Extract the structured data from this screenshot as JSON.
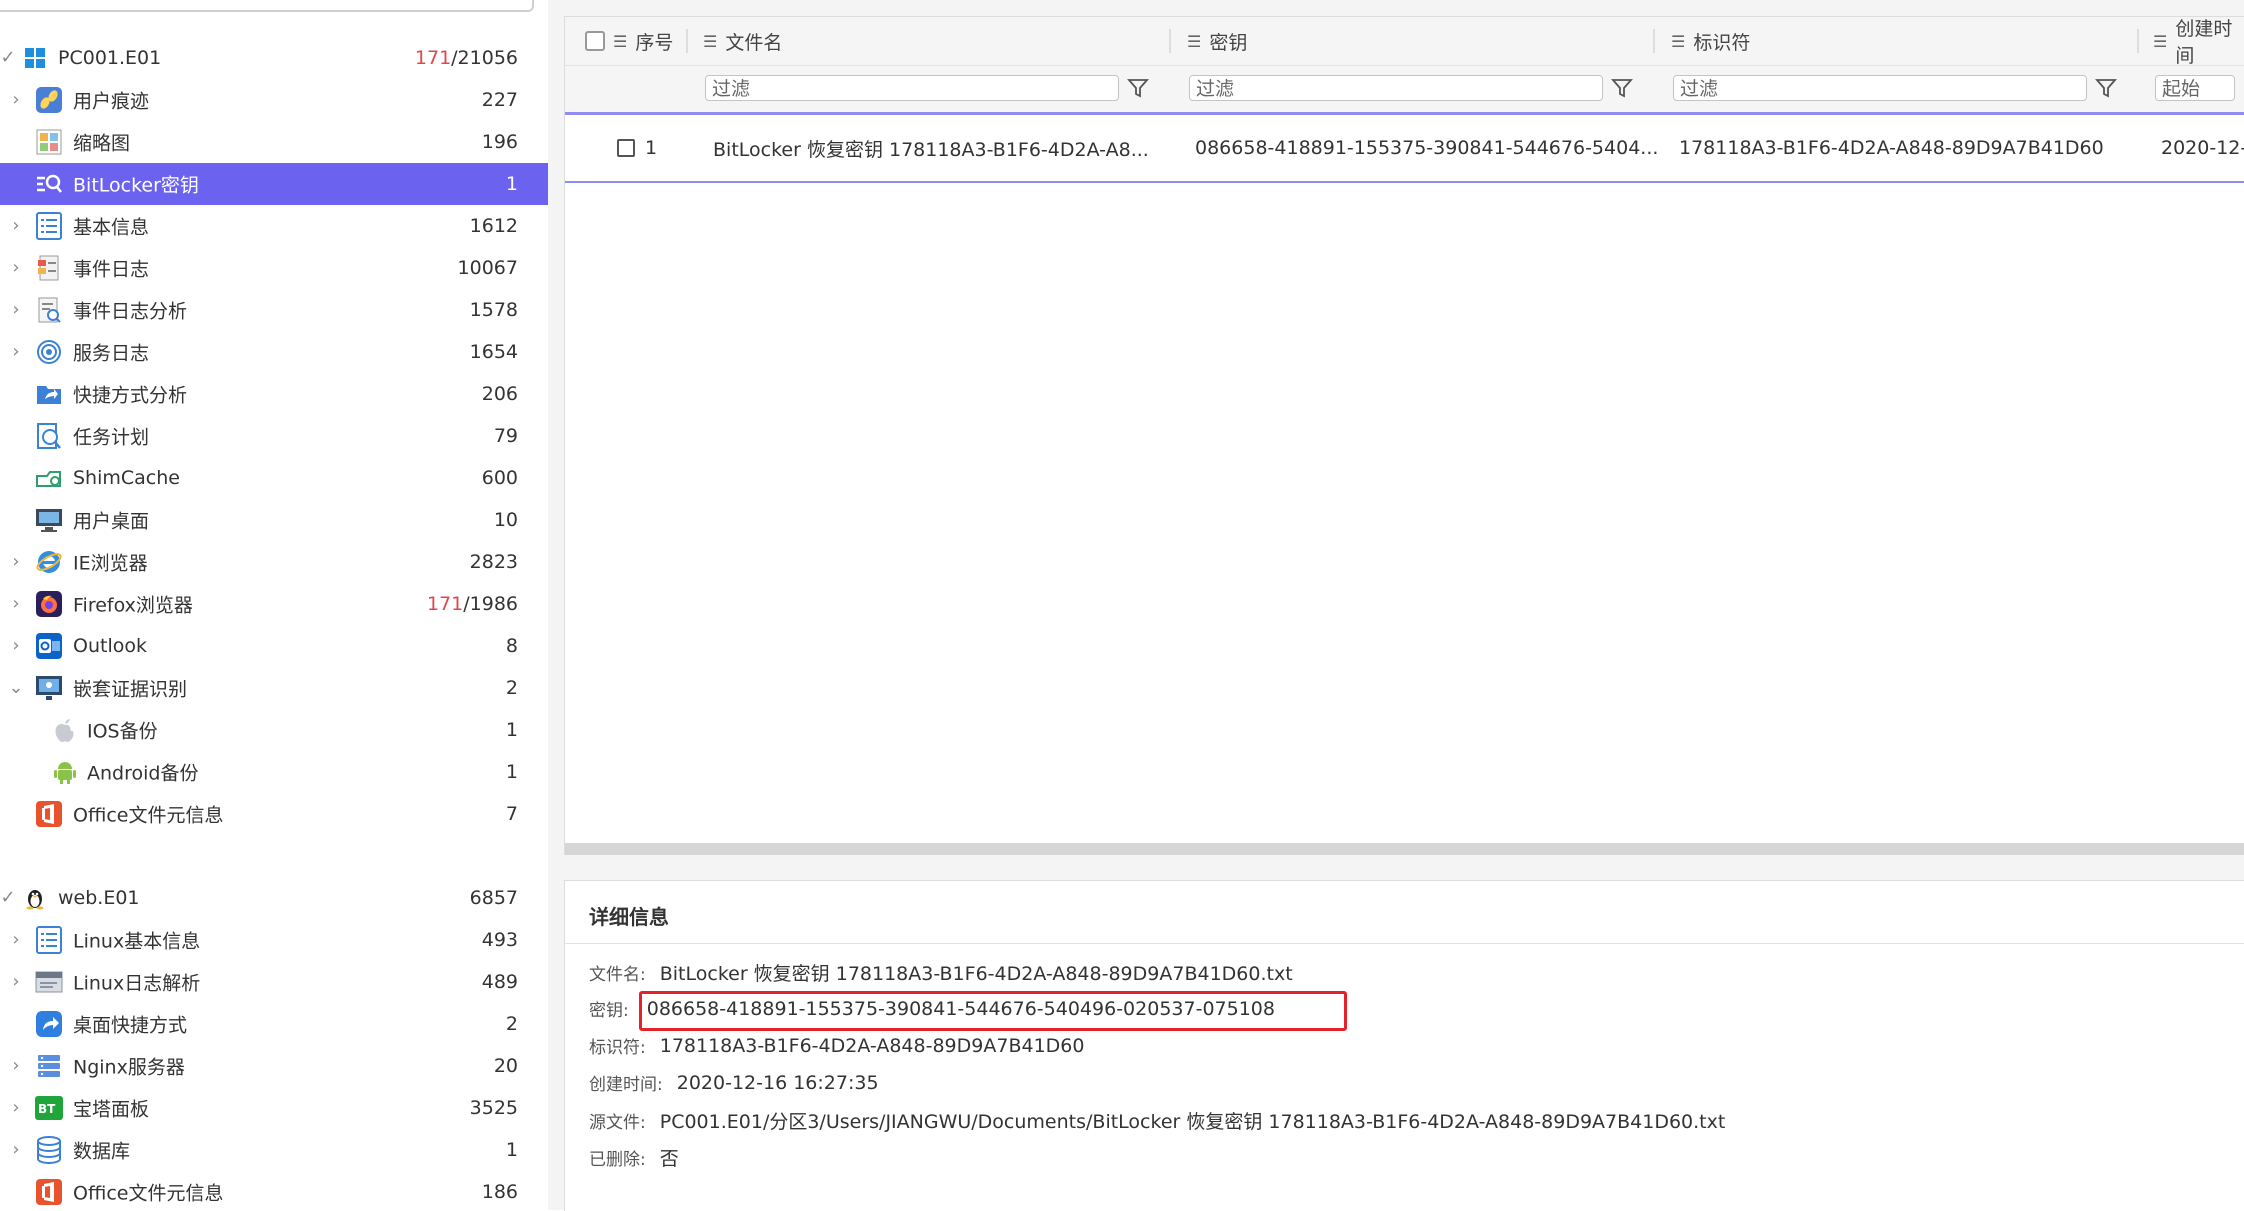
{
  "tree": {
    "groups": [
      {
        "label": "PC001.E01",
        "count_red": "171",
        "count_rest": "/21056"
      },
      {
        "label": "web.E01",
        "count": "6857"
      }
    ],
    "pc_items": [
      {
        "label": "用户痕迹",
        "count": "227",
        "icon": "footprint-icon"
      },
      {
        "label": "缩略图",
        "count": "196",
        "icon": "thumbnail-icon"
      },
      {
        "label": "BitLocker密钥",
        "count": "1",
        "icon": "key-search-icon"
      },
      {
        "label": "基本信息",
        "count": "1612",
        "icon": "info-list-icon"
      },
      {
        "label": "事件日志",
        "count": "10067",
        "icon": "event-log-icon"
      },
      {
        "label": "事件日志分析",
        "count": "1578",
        "icon": "log-analysis-icon"
      },
      {
        "label": "服务日志",
        "count": "1654",
        "icon": "service-log-icon"
      },
      {
        "label": "快捷方式分析",
        "count": "206",
        "icon": "shortcut-folder-icon"
      },
      {
        "label": "任务计划",
        "count": "79",
        "icon": "task-schedule-icon"
      },
      {
        "label": "ShimCache",
        "count": "600",
        "icon": "shimcache-icon"
      },
      {
        "label": "用户桌面",
        "count": "10",
        "icon": "desktop-icon"
      },
      {
        "label": "IE浏览器",
        "count": "2823",
        "icon": "ie-browser-icon"
      },
      {
        "label": "Firefox浏览器",
        "count_red": "171",
        "count_rest": "/1986",
        "icon": "firefox-icon"
      },
      {
        "label": "Outlook",
        "count": "8",
        "icon": "outlook-icon"
      },
      {
        "label": "嵌套证据识别",
        "count": "2",
        "icon": "nested-evidence-icon"
      },
      {
        "label": "IOS备份",
        "count": "1",
        "icon": "apple-icon"
      },
      {
        "label": "Android备份",
        "count": "1",
        "icon": "android-icon"
      },
      {
        "label": "Office文件元信息",
        "count": "7",
        "icon": "office-icon"
      }
    ],
    "web_items": [
      {
        "label": "Linux基本信息",
        "count": "493",
        "icon": "info-list-icon"
      },
      {
        "label": "Linux日志解析",
        "count": "489",
        "icon": "log-file-icon"
      },
      {
        "label": "桌面快捷方式",
        "count": "2",
        "icon": "shortcut-icon"
      },
      {
        "label": "Nginx服务器",
        "count": "20",
        "icon": "server-icon"
      },
      {
        "label": "宝塔面板",
        "count": "3525",
        "icon": "bt-panel-icon"
      },
      {
        "label": "数据库",
        "count": "1",
        "icon": "database-icon"
      },
      {
        "label": "Office文件元信息",
        "count": "186",
        "icon": "office-icon"
      }
    ]
  },
  "grid": {
    "columns": [
      "序号",
      "文件名",
      "密钥",
      "标识符",
      "创建时间"
    ],
    "filter_placeholder": "过滤",
    "date_placeholder": "起始",
    "rows": [
      {
        "index": "1",
        "filename": "BitLocker 恢复密钥 178118A3-B1F6-4D2A-A8...",
        "key": "086658-418891-155375-390841-544676-5404...",
        "identifier": "178118A3-B1F6-4D2A-A848-89D9A7B41D60",
        "created": "2020-12-"
      }
    ]
  },
  "detail": {
    "title": "详细信息",
    "fields": [
      {
        "label": "文件名:",
        "value": "BitLocker 恢复密钥 178118A3-B1F6-4D2A-A848-89D9A7B41D60.txt"
      },
      {
        "label": "密钥:",
        "value": "086658-418891-155375-390841-544676-540496-020537-075108"
      },
      {
        "label": "标识符:",
        "value": "178118A3-B1F6-4D2A-A848-89D9A7B41D60"
      },
      {
        "label": "创建时间:",
        "value": "2020-12-16 16:27:35"
      },
      {
        "label": "源文件:",
        "value": "PC001.E01/分区3/Users/JIANGWU/Documents/BitLocker 恢复密钥 178118A3-B1F6-4D2A-A848-89D9A7B41D60.txt"
      },
      {
        "label": "已删除:",
        "value": "否"
      }
    ]
  },
  "colors": {
    "accent": "#6b63f0",
    "highlight_box": "#e3222c",
    "count_red": "#e0474c"
  }
}
